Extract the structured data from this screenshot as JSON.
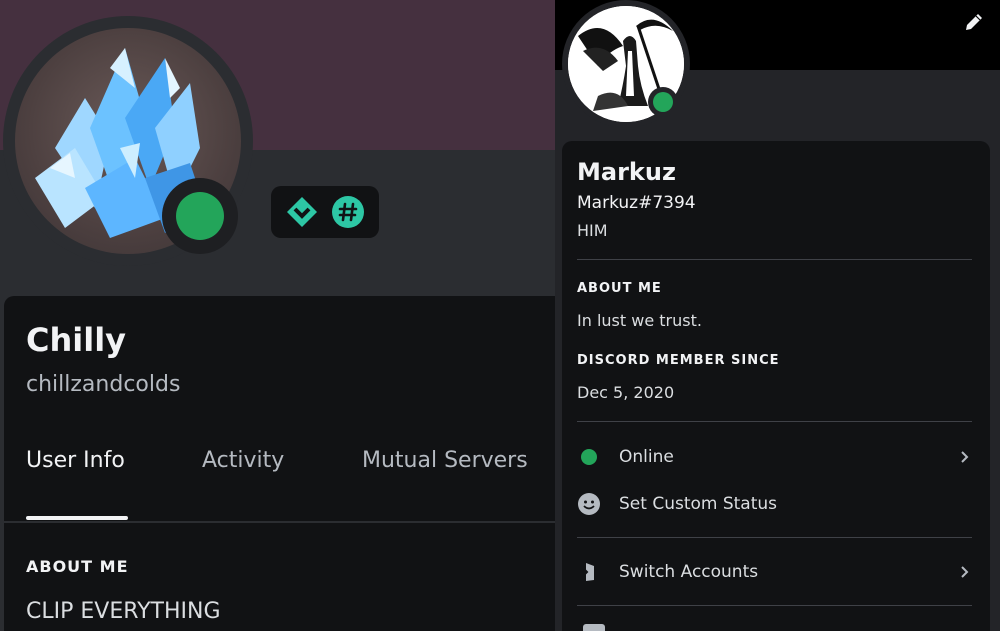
{
  "left_profile": {
    "display_name": "Chilly",
    "username": "chillzandcolds",
    "status_color": "#23a55a",
    "badge_color": "#2dc7a5",
    "badges": [
      "hypesquad-diamond-icon",
      "hashtag-icon"
    ],
    "tabs": [
      {
        "label": "User Info",
        "active": true
      },
      {
        "label": "Activity",
        "active": false
      },
      {
        "label": "Mutual Servers",
        "active": false
      }
    ],
    "about_me_heading": "ABOUT ME",
    "about_me_text": "CLIP EVERYTHING"
  },
  "right_profile": {
    "display_name": "Markuz",
    "tag": "Markuz#7394",
    "pronouns": "HIM",
    "about_me_heading": "ABOUT ME",
    "about_me_text": "In lust we trust.",
    "member_since_heading": "DISCORD MEMBER SINCE",
    "member_since_date": "Dec 5, 2020",
    "status_color": "#23a55a",
    "menu": {
      "online_label": "Online",
      "custom_status_label": "Set Custom Status",
      "switch_accounts_label": "Switch Accounts"
    }
  }
}
